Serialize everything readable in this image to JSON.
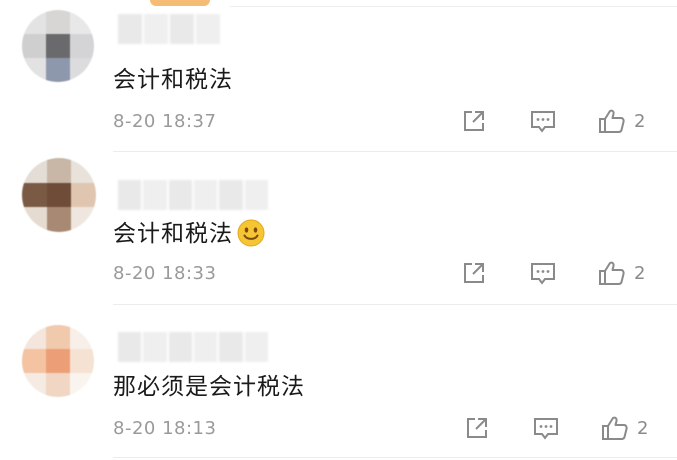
{
  "comments": [
    {
      "text": "会计和税法",
      "time": "8-20 18:37",
      "likes": "2",
      "has_emoji": false,
      "emoji": ""
    },
    {
      "text": "会计和税法",
      "time": "8-20 18:33",
      "likes": "2",
      "has_emoji": true,
      "emoji": "smiley-face-icon"
    },
    {
      "text": "那必须是会计税法",
      "time": "8-20 18:13",
      "likes": "2",
      "has_emoji": false,
      "emoji": ""
    }
  ],
  "icons": {
    "share": "share-icon",
    "reply": "comment-icon",
    "like": "thumbs-up-icon"
  },
  "colors": {
    "text": "#1a1a1a",
    "muted": "#9a9a9a",
    "icon": "#8a8a8a",
    "divider": "#ececec",
    "emoji_face": "#f6c533"
  }
}
